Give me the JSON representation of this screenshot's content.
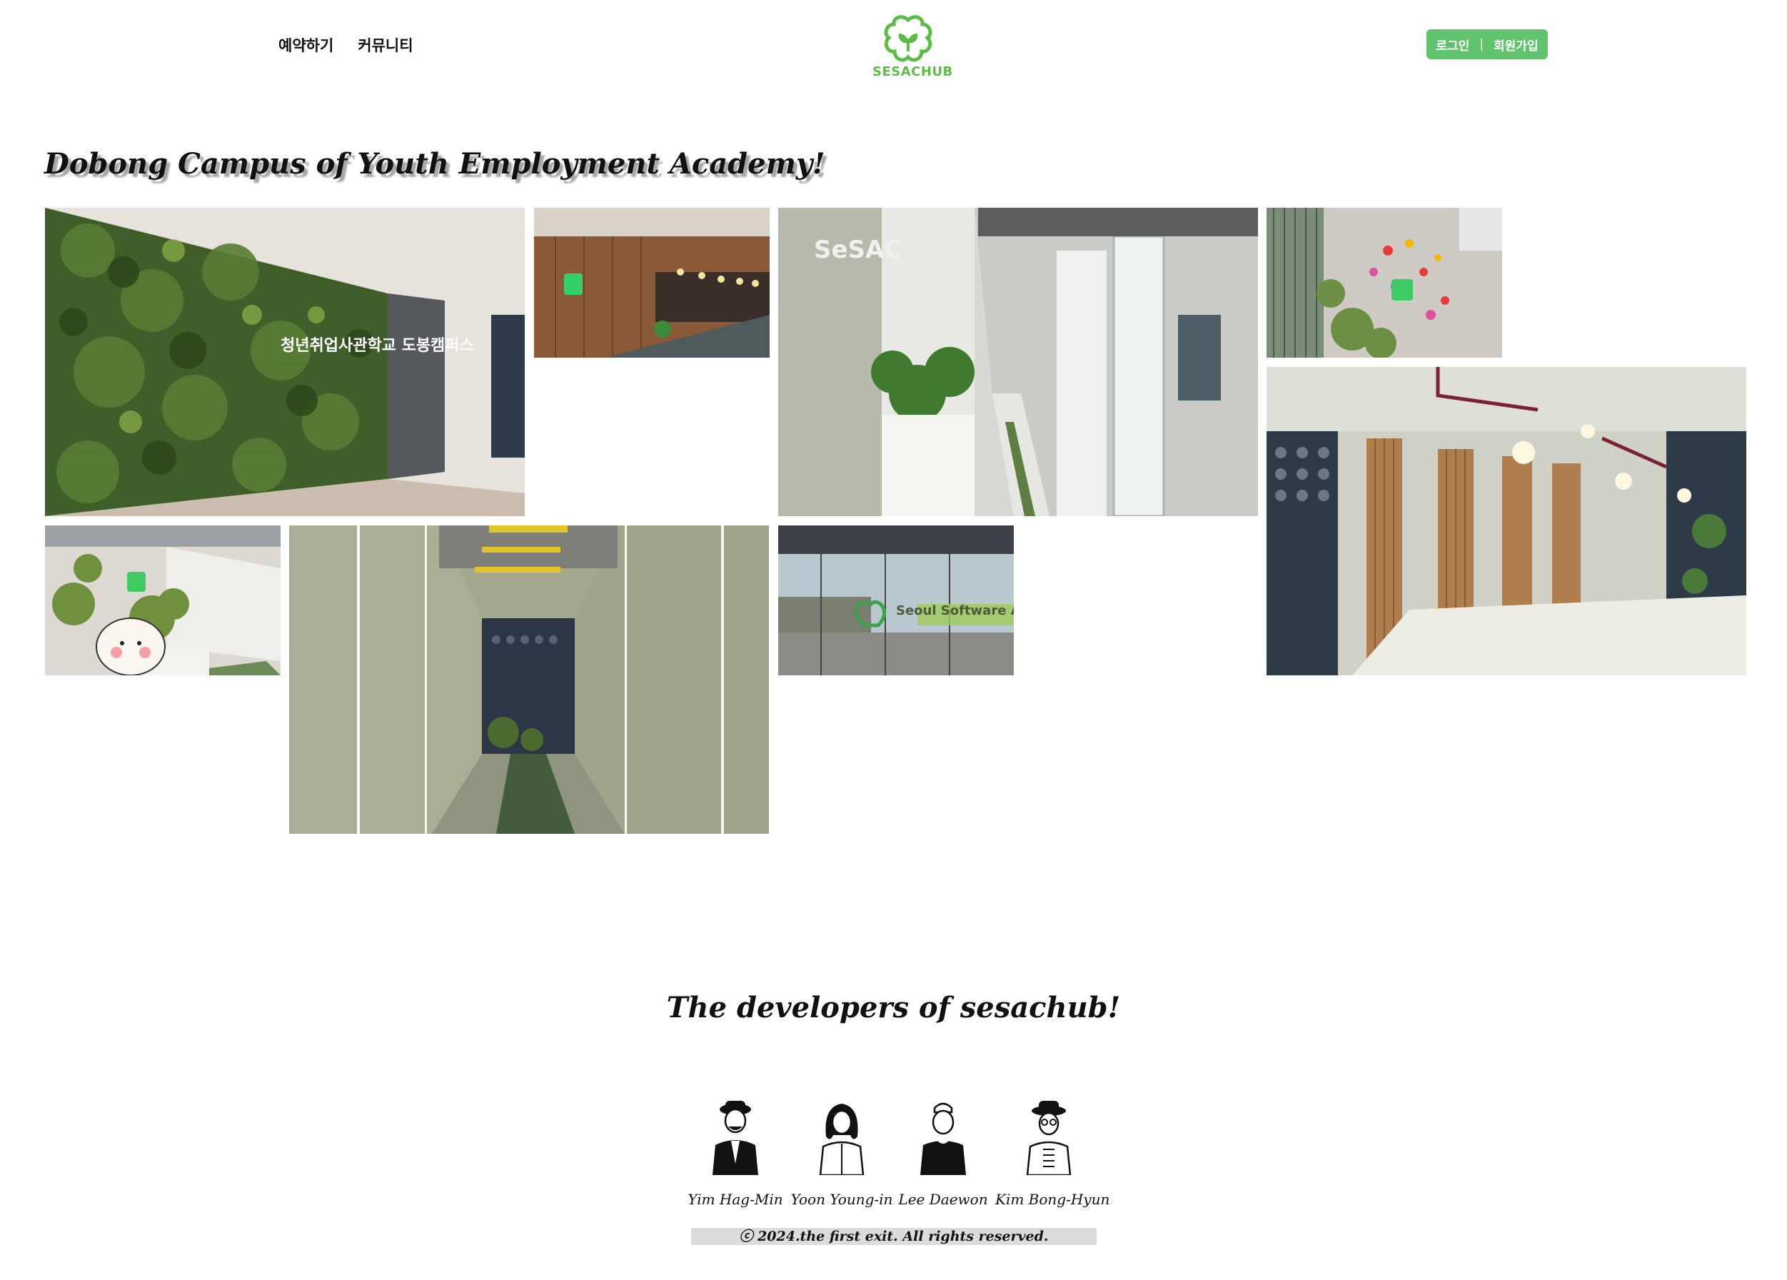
{
  "header": {
    "nav": [
      "예약하기",
      "커뮤니티"
    ],
    "logo_text": "SESACHUB",
    "login_label": "로그인",
    "separator": "|",
    "signup_label": "회원가입"
  },
  "gallery": {
    "title": "Dobong Campus of Youth Employment Academy!",
    "photos": [
      {
        "subject": "living green wall with campus sign"
      },
      {
        "subject": "wood-panel reception lounge with logo"
      },
      {
        "subject": "white corridor with planters and glass rooms"
      },
      {
        "subject": "plant wall with colorful logo display"
      },
      {
        "subject": "lounge with wood pillars and long white table"
      },
      {
        "subject": "hallway with mascot character and green logo"
      },
      {
        "subject": "sage-green tunnel corridor"
      },
      {
        "subject": "glass wall with Seoul Software Academy lettering"
      }
    ],
    "sign_texts": {
      "green_wall": "청년취업사관학교 도봉캠퍼스",
      "academy_glass": "Seoul Software Academy"
    }
  },
  "developers": {
    "title": "The developers of sesachub!",
    "people": [
      {
        "name": "Yim Hag-Min",
        "avatar": "person-with-hat-jacket-icon"
      },
      {
        "name": "Yoon Young-in",
        "avatar": "person-long-hair-icon"
      },
      {
        "name": "Lee Daewon",
        "avatar": "person-tshirt-icon"
      },
      {
        "name": "Kim Bong-Hyun",
        "avatar": "person-hat-glasses-icon"
      }
    ]
  },
  "footer": {
    "copyright": "ⓒ 2024.the first exit. All rights reserved."
  },
  "colors": {
    "brand_green": "#5dbb4a",
    "button_green": "#62c36e"
  }
}
